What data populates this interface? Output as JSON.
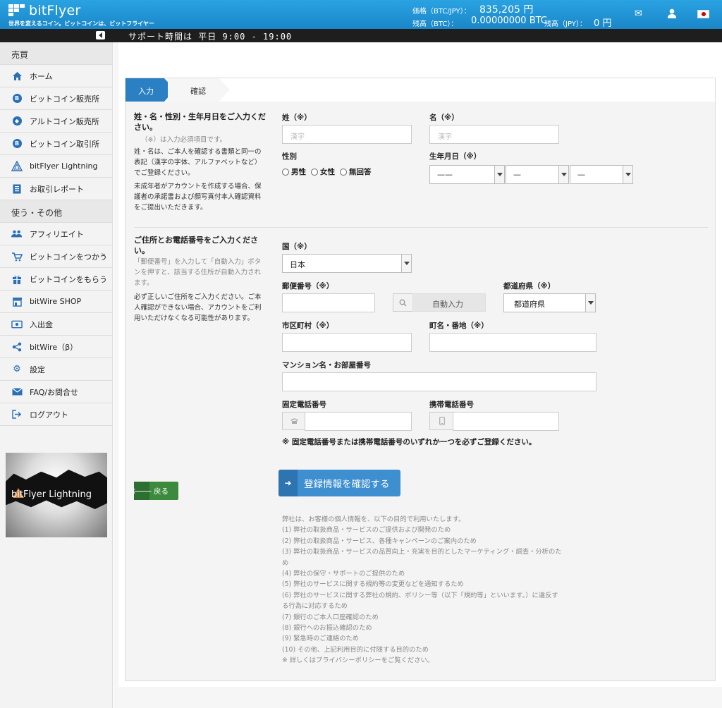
{
  "header": {
    "logo_text": "bitFlyer",
    "tagline": "世界を変えるコイン。ビットコインは、ビットフライヤー",
    "price_label": "価格（BTC/JPY）：",
    "price_value": "835,205 円",
    "balance_btc_label": "残高（BTC）：",
    "balance_btc_value": "0.00000000 BTC",
    "balance_jpy_label": "残高（JPY）：",
    "balance_jpy_value": "0 円"
  },
  "support_hours": "サポート時間は 平日 9:00 - 19:00",
  "sidebar": {
    "sections": [
      "売買",
      "使う・その他"
    ],
    "trade_items": [
      {
        "label": "ホーム",
        "icon": "home-icon"
      },
      {
        "label": "ビットコイン販売所",
        "icon": "bitcoin-icon"
      },
      {
        "label": "アルトコイン販売所",
        "icon": "ethereum-icon"
      },
      {
        "label": "ビットコイン取引所",
        "icon": "bitcoin-icon"
      },
      {
        "label": "bitFlyer Lightning",
        "icon": "lightning-icon"
      },
      {
        "label": "お取引レポート",
        "icon": "report-icon"
      }
    ],
    "other_items": [
      {
        "label": "アフィリエイト",
        "icon": "users-icon"
      },
      {
        "label": "ビットコインをつかう",
        "icon": "cart-icon"
      },
      {
        "label": "ビットコインをもらう",
        "icon": "gift-icon"
      },
      {
        "label": "bitWire SHOP",
        "icon": "shop-icon"
      },
      {
        "label": "入出金",
        "icon": "money-icon"
      },
      {
        "label": "bitWire（β）",
        "icon": "share-icon"
      },
      {
        "label": "設定",
        "icon": "gear-icon"
      },
      {
        "label": "FAQ/お問合せ",
        "icon": "mail-icon"
      },
      {
        "label": "ログアウト",
        "icon": "logout-icon"
      }
    ],
    "banner_text": "bitFlyer Lightning"
  },
  "steps": {
    "step1": "入力",
    "step2": "確認"
  },
  "section1": {
    "title": "姓・名・性別・生年月日をご入力ください。",
    "required_note": "（※）は入力必須項目です。",
    "desc1": "姓・名は、ご本人を確認する書類と同一の表記（漢字の字体、アルファベットなど）でご登録ください。",
    "desc2": "未成年者がアカウントを作成する場合、保護者の承諾書および顔写真付本人確認資料をご提出いただきます。",
    "last_name_label": "姓（※）",
    "last_name_placeholder": "漢字",
    "first_name_label": "名（※）",
    "first_name_placeholder": "漢字",
    "gender_label": "性別",
    "gender_options": [
      "男性",
      "女性",
      "無回答"
    ],
    "birthdate_label": "生年月日（※）",
    "year_value": "——",
    "month_value": "—",
    "day_value": "—"
  },
  "section2": {
    "title": "ご住所とお電話番号をご入力ください。",
    "desc1": "「郵便番号」を入力して「自動入力」ボタンを押すと、該当する住所が自動入力されます。",
    "desc2": "必ず正しいご住所をご入力ください。ご本人確認ができない場合、アカウントをご利用いただけなくなる可能性があります。",
    "country_label": "国（※）",
    "country_value": "日本",
    "postal_label": "郵便番号（※）",
    "auto_fill_label": "自動入力",
    "prefecture_label": "都道府県（※）",
    "prefecture_value": "都道府県",
    "city_label": "市区町村（※）",
    "street_label": "町名・番地（※）",
    "building_label": "マンション名・お部屋番号",
    "landline_label": "固定電話番号",
    "mobile_label": "携帯電話番号",
    "phone_note": "※ 固定電話番号または携帯電話番号のいずれか一つを必ずご登録ください。"
  },
  "buttons": {
    "back": "戻る",
    "confirm": "登録情報を確認する"
  },
  "privacy": {
    "intro": "弊社は、お客様の個人情報を、以下の目的で利用いたします。",
    "items": [
      "(1) 弊社の取扱商品・サービスのご提供および開発のため",
      "(2) 弊社の取扱商品・サービス、各種キャンペーンのご案内のため",
      "(3) 弊社の取扱商品・サービスの品質向上・充実を目的としたマーケティング・調査・分析のため",
      "(4) 弊社の保守・サポートのご提供のため",
      "(5) 弊社のサービスに関する規約等の変更などを通知するため",
      "(6) 弊社のサービスに関する弊社の規約、ポリシー等（以下「規約等」といいます。）に違反する行為に対応するため",
      "(7) 銀行のご本人口座確認のため",
      "(8) 銀行へのお振込確認のため",
      "(9) 緊急時のご連絡のため",
      "(10) その他、上記利用目的に付随する目的のため"
    ],
    "footer": "※ 詳しくはプライバシーポリシーをご覧ください。"
  }
}
